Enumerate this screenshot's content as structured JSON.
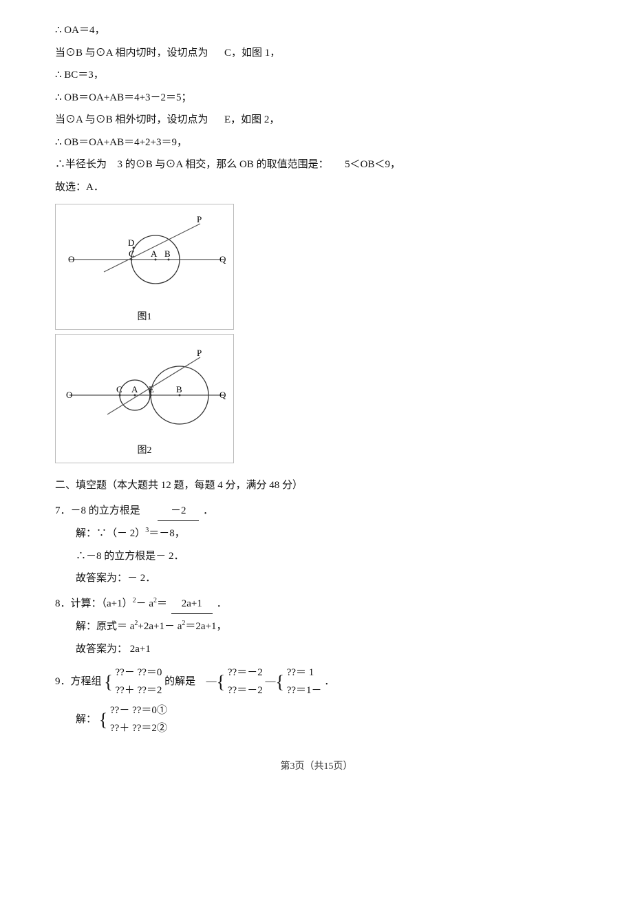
{
  "lines": {
    "l1": "∴ OA＝4，",
    "l2": "当⊙B 与⊙A 相内切时，设切点为",
    "l2b": "C，如图 1，",
    "l3": "∴ BC＝3，",
    "l4": "∴ OB＝OA+AB＝4+3－2＝5；",
    "l5": "当⊙A 与⊙B 相外切时，设切点为",
    "l5b": "E，如图 2，",
    "l6": "∴ OB＝OA+AB＝4+2+3＝9，",
    "l7": "∴半径长为",
    "l7b": "3 的⊙B 与⊙A 相交，那么 OB 的取值范围是：",
    "l7c": "5＜OB＜9，",
    "l8": "故选：A．",
    "fig1_label": "图1",
    "fig2_label": "图2",
    "section": "二、填空题（本大题共    12 题，每题  4 分，满分  48 分）",
    "q7": "7．－8 的立方根是",
    "q7_ans": "－2",
    "q7_period": "．",
    "q7_sol1": "解：∵（－ 2）",
    "q7_sol1b": "3",
    "q7_sol1c": "＝－8，",
    "q7_sol2": "∴－8 的立方根是－ 2．",
    "q7_sol3": "故答案为：－ 2．",
    "q8": "8．计算：（a+1）",
    "q8_exp": "2",
    "q8b": "－ a",
    "q8_exp2": "2",
    "q8c": "＝",
    "q8_ans": "2a+1",
    "q8_period": "．",
    "q8_sol1": "解：原式＝ a",
    "q8_sol1_exp": "2",
    "q8_sol1b": "+2a+1－ a",
    "q8_sol1b_exp": "2",
    "q8_sol1c": "＝2a+1，",
    "q8_sol2": "故答案为：   2a+1",
    "q9": "9．方程组",
    "q9_sys1_1": "??－  ??＝0",
    "q9_sys1_2": "??＋ ??＝2",
    "q9_ans_text": "的解是",
    "q9_ans1_1": "??＝－2",
    "q9_ans1_2": "??＝－2",
    "q9_ans2_1": "??＝ 1",
    "q9_ans2_2": "??＝1－",
    "q9_period": "．",
    "q9_sol": "解：",
    "q9_sol_sys_1": "??－  ??＝0①",
    "q9_sol_sys_2": "??＋ ??＝2②",
    "page_num": "第3页（共15页）"
  }
}
